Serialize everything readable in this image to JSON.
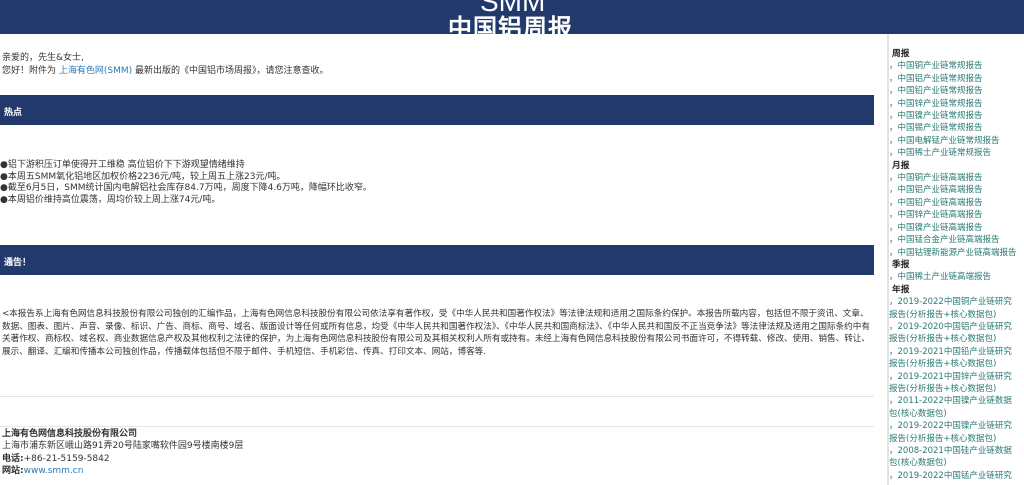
{
  "header": {
    "logo_text": "SMM",
    "title": "中国铝周报",
    "background": "#21396b"
  },
  "greeting": {
    "line1": "亲爱的，先生&女士,",
    "line2_prefix": "您好！附件为",
    "link_text": "上海有色网(SMM)",
    "line2_suffix": "最新出版的《中国铝市场周报》，请您注意查收。"
  },
  "sections": {
    "hot_label": "热点",
    "notice_label": "通告！"
  },
  "hot_items": [
    "●铝下游积压订单使得开工维稳 高位铝价下下游观望情绪维持",
    "●本周五SMM氧化铝地区加权价格2236元/吨，较上周五上涨23元/吨。",
    "●截至6月5日，SMM统计国内电解铝社会库存84.7万吨，周度下降4.6万吨，降幅环比收窄。",
    "●本周铝价维持高位震荡，周均价较上周上涨74元/吨。"
  ],
  "copyright": "<本报告系上海有色网信息科技股份有限公司独创的汇编作品，上海有色网信息科技股份有限公司依法享有著作权，受《中华人民共和国著作权法》等法律法规和适用之国际条约保护。本报告所载内容，包括但不限于资讯、文章、数据、图表、图片、声音、录像、标识、广告、商标、商号、域名、版面设计等任何或所有信息，均受《中华人民共和国著作权法》、《中华人民共和国商标法》、《中华人民共和国反不正当竞争法》等法律法规及适用之国际条约中有关著作权、商标权、域名权、商业数据信息产权及其他权利之法律的保护，为上海有色网信息科技股份有限公司及其相关权利人所有或持有。未经上海有色网信息科技股份有限公司书面许可，不得转载、修改、使用、销售、转让、展示、翻译、汇编和传播本公司独创作品，传播载体包括但不限于邮件、手机短信、手机彩信、传真、打印文本、网站，博客等.",
  "company": {
    "name": "上海有色网信息科技股份有限公司",
    "address": "上海市浦东新区峨山路91弄20号陆家嘴软件园9号楼南楼9层",
    "phone_label": "电话:",
    "phone": "+86-21-5159-5842",
    "site_label": "网站:",
    "site": "www.smm.cn"
  },
  "sidebar": {
    "weekly_label": "周报",
    "weekly": [
      "，中国铜产业链常规报告",
      "，中国铝产业链常规报告",
      "，中国铅产业链常规报告",
      "，中国锌产业链常规报告",
      "，中国镍产业链常规报告",
      "，中国锡产业链常规报告",
      "，中国电解锰产业链常规报告",
      "，中国稀土产业链常规报告"
    ],
    "monthly_label": "月报",
    "monthly": [
      "，中国铜产业链高端报告",
      "，中国铝产业链高端报告",
      "，中国铅产业链高端报告",
      "，中国锌产业链高端报告",
      "，中国镍产业链高端报告",
      "，中国锰合金产业链高端报告",
      "，中国钴锂新能源产业链高端报告"
    ],
    "quarterly_label": "季报",
    "quarterly": [
      "，中国稀土产业链高端报告"
    ],
    "annual_label": "年报",
    "annual": [
      "，2019-2022中国铜产业链研究报告(分析报告+核心数据包)",
      "，2019-2020中国铝产业链研究报告(分析报告+核心数据包)",
      "，2019-2021中国铅产业链研究报告(分析报告+核心数据包)",
      "，2019-2021中国锌产业链研究报告(分析报告+核心数据包)",
      "，2011-2022中国镍产业链数据包(核心数据包)",
      "，2019-2022中国镍产业链研究报告(分析报告+核心数据包)",
      "，2008-2021中国硅产业链数据包(核心数据包)",
      "，2019-2022中国锰产业链研究"
    ]
  }
}
